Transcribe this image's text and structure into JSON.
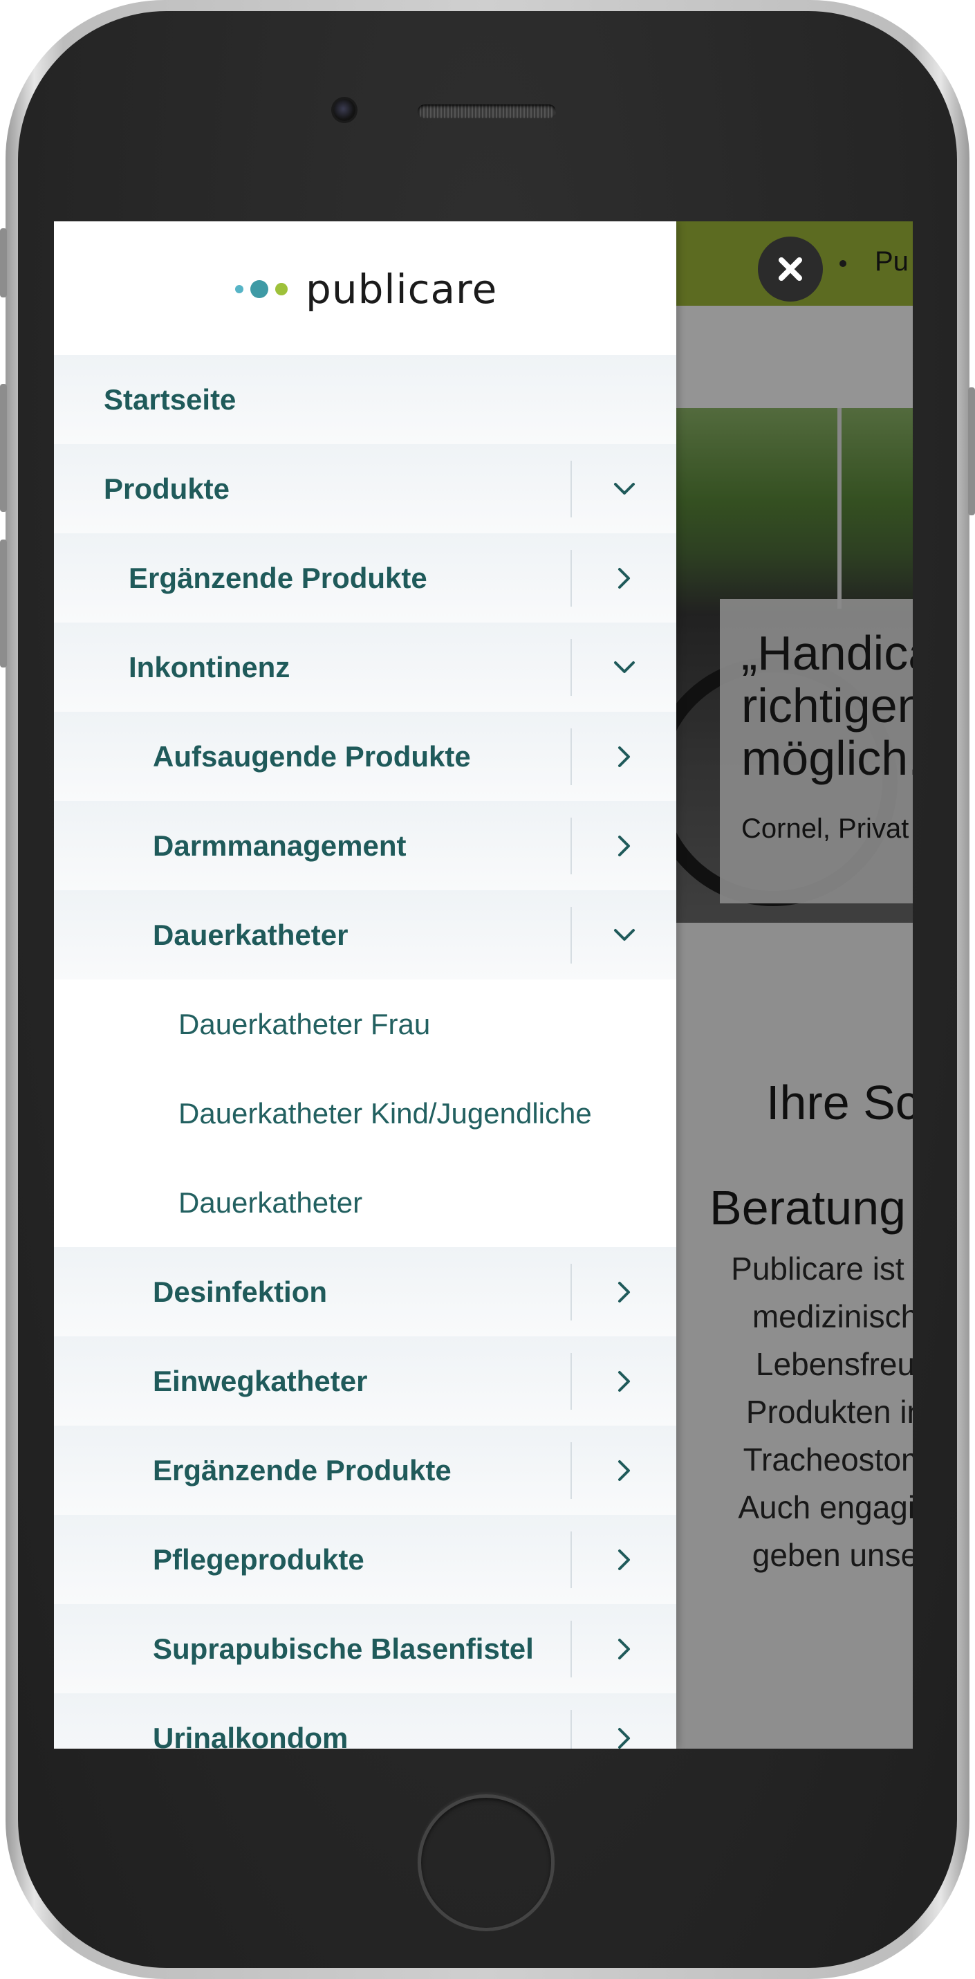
{
  "background_page": {
    "breadcrumb": "Pu",
    "quote": "„Handica\nrichtigen\nmöglich.",
    "quote_author": "Cornel, Privat",
    "heading_line1": "Ihre Sc",
    "heading_line2": "Beratung",
    "paragraph_lines": [
      "Publicare ist fü",
      "medizinisch",
      "Lebensfreu",
      "Produkten in",
      "Tracheostom",
      "Auch engagie",
      "geben unse"
    ]
  },
  "drawer": {
    "logo_text": "publicare",
    "logo_colors": [
      "#56b4c6",
      "#3e9aa5",
      "#9ec13a"
    ],
    "close_icon": "close-icon",
    "items": [
      {
        "label": "Startseite",
        "level": 0,
        "toggle": "none"
      },
      {
        "label": "Produkte",
        "level": 0,
        "toggle": "chevron-down"
      },
      {
        "label": "Ergänzende Produkte",
        "level": 1,
        "toggle": "chevron-right"
      },
      {
        "label": "Inkontinenz",
        "level": 1,
        "toggle": "chevron-down"
      },
      {
        "label": "Aufsaugende Produkte",
        "level": 2,
        "toggle": "chevron-right"
      },
      {
        "label": "Darmmanagement",
        "level": 2,
        "toggle": "chevron-right"
      },
      {
        "label": "Dauerkatheter",
        "level": 2,
        "toggle": "chevron-down"
      },
      {
        "label": "Dauerkatheter Frau",
        "level": 3,
        "toggle": "none"
      },
      {
        "label": "Dauerkatheter Kind/Jugendliche",
        "level": 3,
        "toggle": "none"
      },
      {
        "label": "Dauerkatheter",
        "level": 3,
        "toggle": "none"
      },
      {
        "label": "Desinfektion",
        "level": 2,
        "toggle": "chevron-right"
      },
      {
        "label": "Einwegkatheter",
        "level": 2,
        "toggle": "chevron-right"
      },
      {
        "label": "Ergänzende Produkte",
        "level": 2,
        "toggle": "chevron-right"
      },
      {
        "label": "Pflegeprodukte",
        "level": 2,
        "toggle": "chevron-right"
      },
      {
        "label": "Suprapubische Blasenfistel",
        "level": 2,
        "toggle": "chevron-right"
      },
      {
        "label": "Urinalkondom",
        "level": 2,
        "toggle": "chevron-right"
      }
    ]
  },
  "colors": {
    "menu_text": "#1f5a5a",
    "top_bar": "#9fb83a",
    "close_button": "#2b2b2b"
  }
}
